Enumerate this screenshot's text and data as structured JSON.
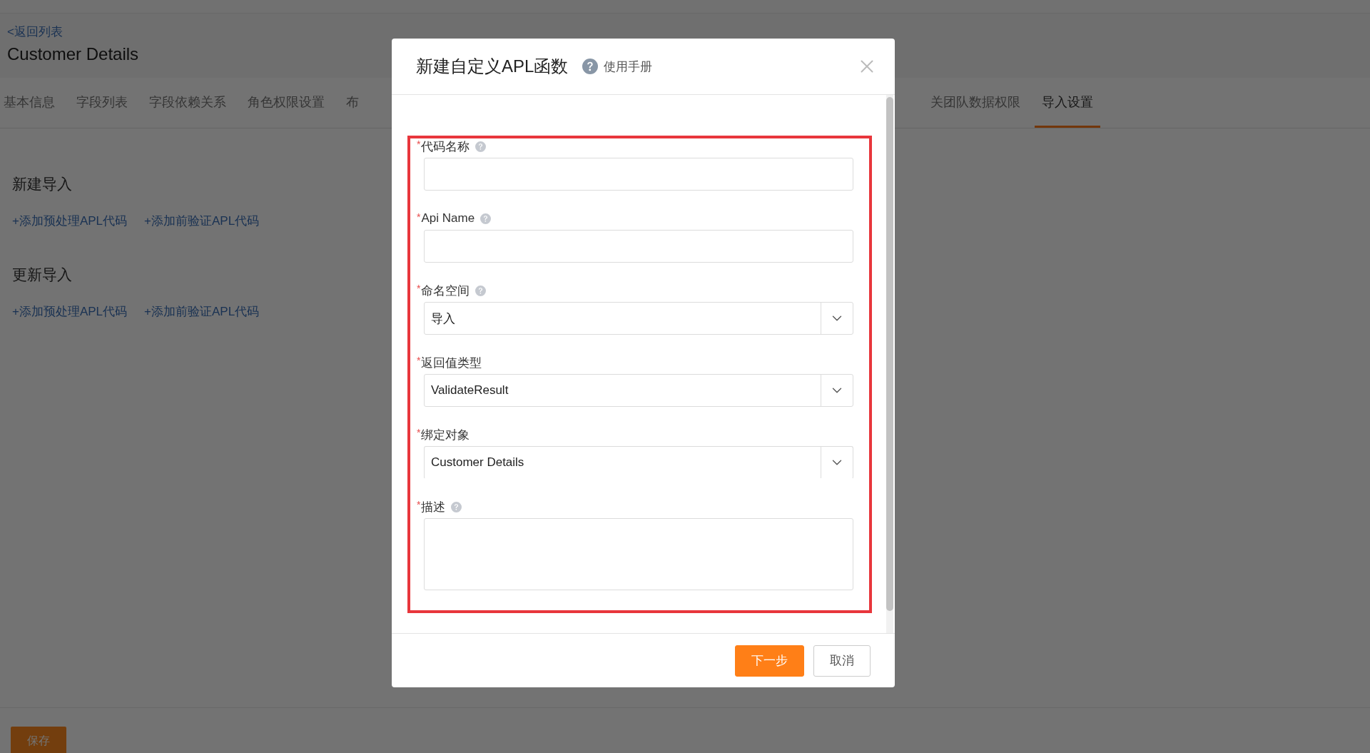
{
  "header": {
    "back_link": "<返回列表",
    "title": "Customer Details"
  },
  "tabs_left": [
    {
      "label": "基本信息",
      "selected": false
    },
    {
      "label": "字段列表",
      "selected": false
    },
    {
      "label": "字段依赖关系",
      "selected": false
    },
    {
      "label": "角色权限设置",
      "selected": false
    },
    {
      "label": "布",
      "selected": false
    }
  ],
  "tabs_right": [
    {
      "label": "关团队数据权限",
      "selected": false
    },
    {
      "label": "导入设置",
      "selected": true
    }
  ],
  "sections": [
    {
      "title": "新建导入",
      "links": [
        "+添加预处理APL代码",
        "+添加前验证APL代码"
      ]
    },
    {
      "title": "更新导入",
      "links": [
        "+添加预处理APL代码",
        "+添加前验证APL代码"
      ]
    }
  ],
  "save_button": "保存",
  "dialog": {
    "title": "新建自定义APL函数",
    "manual_link": "使用手册",
    "fields": [
      {
        "kind": "input",
        "label": "代码名称",
        "required_mark": "*",
        "help": true
      },
      {
        "kind": "input",
        "label": "Api Name",
        "required_mark": "*",
        "help": true
      },
      {
        "kind": "select",
        "label": "命名空间",
        "required_mark": "*",
        "help": true,
        "value": "导入"
      },
      {
        "kind": "select",
        "label": "返回值类型",
        "required_mark": "*",
        "help": false,
        "value": "ValidateResult"
      },
      {
        "kind": "select",
        "label": "绑定对象",
        "required_mark": "*",
        "help": false,
        "value": "Customer Details"
      },
      {
        "kind": "textarea",
        "label": "描述",
        "required_mark": "*",
        "help": true
      }
    ],
    "buttons": [
      {
        "label": "下一步",
        "kind": "primary"
      },
      {
        "label": "取消",
        "kind": "default"
      }
    ]
  }
}
